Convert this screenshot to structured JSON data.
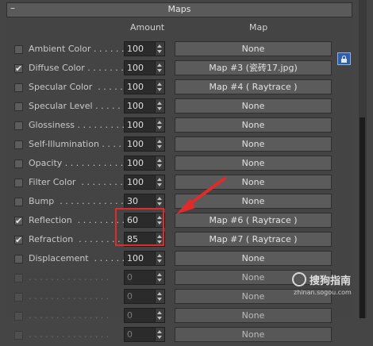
{
  "panel": {
    "title": "Maps",
    "collapse_symbol": "–",
    "col_amount": "Amount",
    "col_map": "Map"
  },
  "rows": [
    {
      "label": "Ambient Color . . . . . . .",
      "checked": false,
      "amount": "100",
      "map": "None"
    },
    {
      "label": "Diffuse Color . . . . . . .",
      "checked": true,
      "amount": "100",
      "map": "Map #3 (瓷砖17.jpg)"
    },
    {
      "label": "Specular Color  . . . . . .",
      "checked": false,
      "amount": "100",
      "map": "Map #4  ( Raytrace )"
    },
    {
      "label": "Specular Level . . . . . .",
      "checked": false,
      "amount": "100",
      "map": "None"
    },
    {
      "label": "Glossiness . . . . . . . . .",
      "checked": false,
      "amount": "100",
      "map": "None"
    },
    {
      "label": "Self-Illumination . . . . .",
      "checked": false,
      "amount": "100",
      "map": "None"
    },
    {
      "label": "Opacity . . . . . . . . . . .",
      "checked": false,
      "amount": "100",
      "map": "None"
    },
    {
      "label": "Filter Color  . . . . . . . .",
      "checked": false,
      "amount": "100",
      "map": "None"
    },
    {
      "label": "Bump  . . . . . . . . . . . .",
      "checked": false,
      "amount": "30",
      "map": "None"
    },
    {
      "label": "Reflection  . . . . . . . . .",
      "checked": true,
      "amount": "60",
      "map": "Map #6  ( Raytrace )"
    },
    {
      "label": "Refraction  . . . . . . . . .",
      "checked": true,
      "amount": "85",
      "map": "Map #7  ( Raytrace )"
    },
    {
      "label": "Displacement  . . . . . . .",
      "checked": false,
      "amount": "100",
      "map": "None"
    },
    {
      "label": ". . . . . . . . . . . . . . .",
      "checked": false,
      "amount": "0",
      "map": "None",
      "disabled": true
    },
    {
      "label": ". . . . . . . . . . . . . . .",
      "checked": false,
      "amount": "0",
      "map": "None",
      "disabled": true
    },
    {
      "label": ". . . . . . . . . . . . . . .",
      "checked": false,
      "amount": "0",
      "map": "None",
      "disabled": true
    },
    {
      "label": ". . . . . . . . . . . . . . .",
      "checked": false,
      "amount": "0",
      "map": "None",
      "disabled": true
    }
  ],
  "annotation": {
    "color": "#e02b2b"
  },
  "watermark": {
    "text": "搜狗指南",
    "url": "zhinan.sogou.com"
  }
}
